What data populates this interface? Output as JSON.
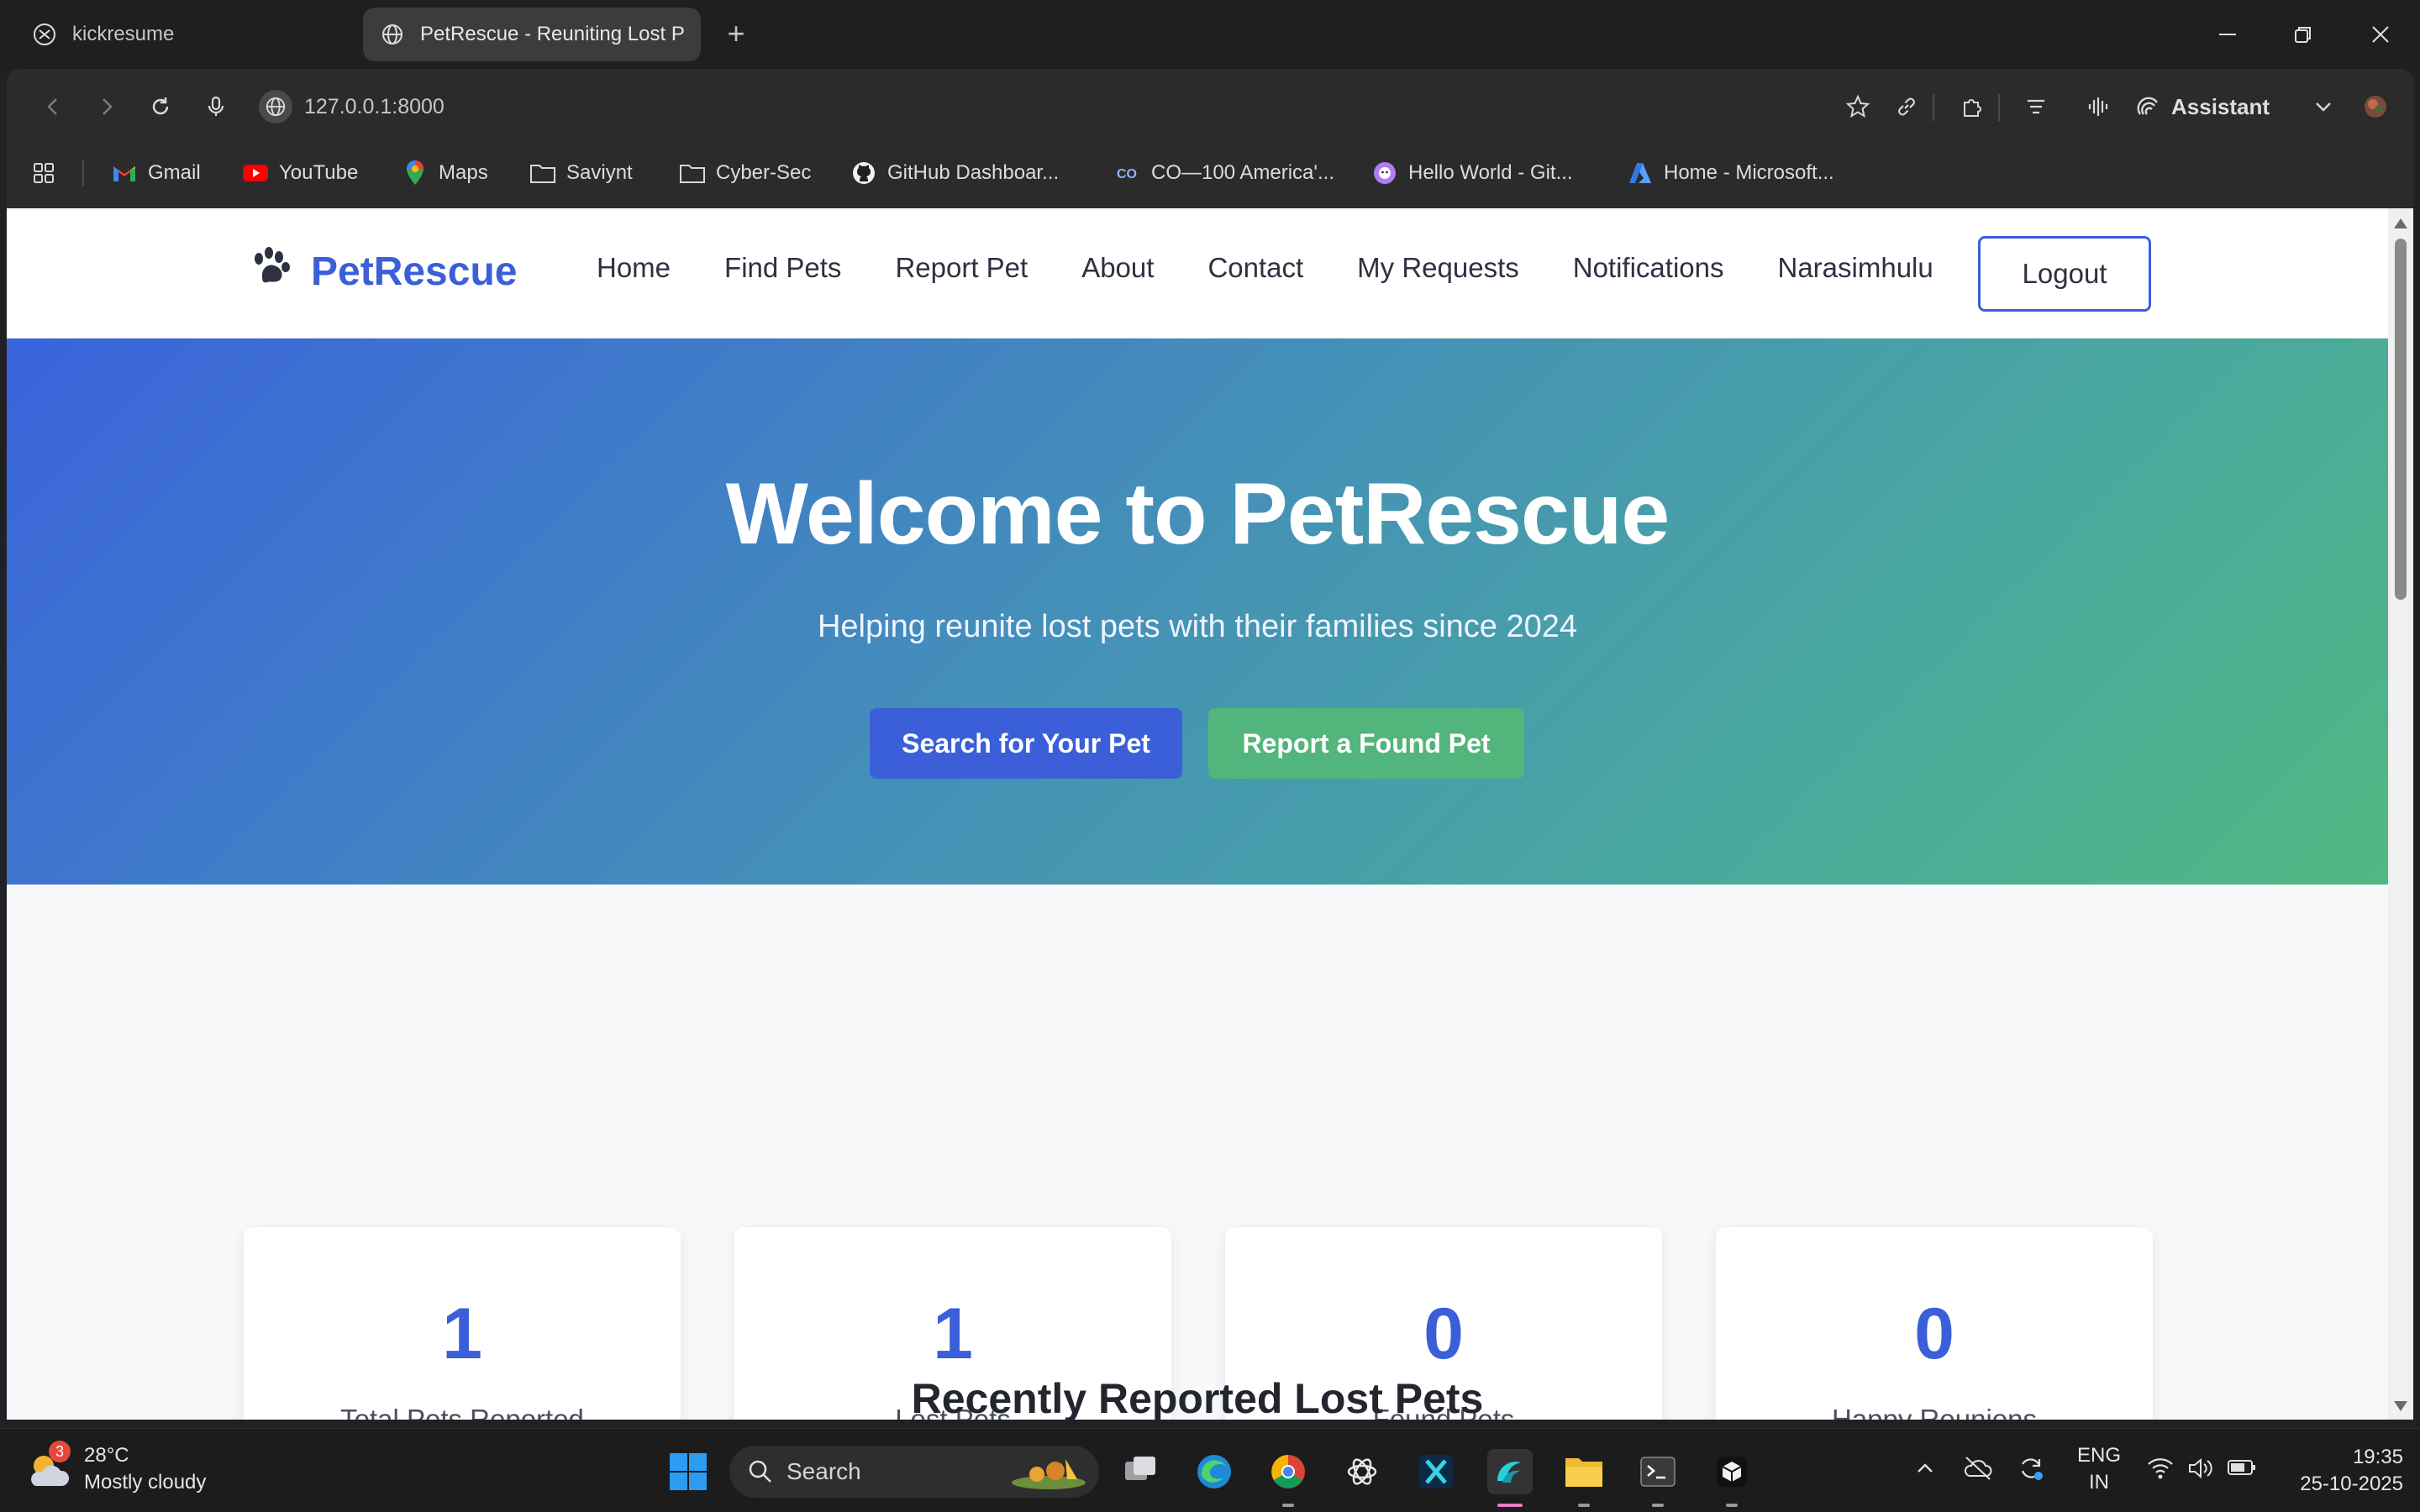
{
  "browser": {
    "tabs": [
      {
        "label": "kickresume",
        "active": false
      },
      {
        "label": "PetRescue - Reuniting Lost Pe",
        "active": true
      }
    ],
    "address": "127.0.0.1:8000",
    "assistant_label": "Assistant",
    "bookmarks": [
      "Gmail",
      "YouTube",
      "Maps",
      "Saviynt",
      "Cyber-Sec",
      "GitHub Dashboar...",
      "CO—100 America'...",
      "Hello World - Git...",
      "Home - Microsoft..."
    ]
  },
  "site": {
    "brand": "PetRescue",
    "nav": [
      "Home",
      "Find Pets",
      "Report Pet",
      "About",
      "Contact",
      "My Requests",
      "Notifications",
      "Narasimhulu"
    ],
    "logout_label": "Logout"
  },
  "hero": {
    "title": "Welcome to PetRescue",
    "subtitle": "Helping reunite lost pets with their families since 2024",
    "primary_button": "Search for Your Pet",
    "secondary_button": "Report a Found Pet"
  },
  "stats": [
    {
      "value": "1",
      "label": "Total Pets Reported"
    },
    {
      "value": "1",
      "label": "Lost Pets"
    },
    {
      "value": "0",
      "label": "Found Pets"
    },
    {
      "value": "0",
      "label": "Happy Reunions"
    }
  ],
  "section_title": "Recently Reported Lost Pets",
  "taskbar": {
    "weather_badge": "3",
    "temperature": "28°C",
    "condition": "Mostly cloudy",
    "search_label": "Search",
    "lang_line1": "ENG",
    "lang_line2": "IN",
    "time": "19:35",
    "date": "25-10-2025"
  },
  "colors": {
    "brand": "#3b5fd8",
    "hero_start": "#3a63dc",
    "hero_end": "#50b882",
    "primary_button": "#3a5fd9",
    "secondary_button": "#52b57b"
  }
}
